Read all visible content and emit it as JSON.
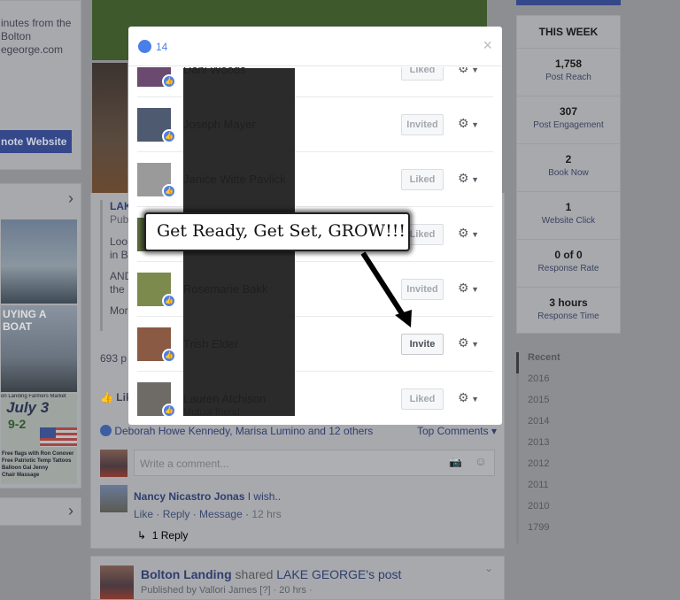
{
  "left": {
    "about_lines": [
      "inutes from the",
      "Bolton",
      "egeorge.com"
    ],
    "promote_button": "note Website",
    "arrow": "›",
    "flyer": {
      "banner": "UYING A BOAT",
      "market": "on Landing Farmers Market",
      "date": "July 3",
      "time": "9-2",
      "features": [
        "Free flags with Ron Conover",
        "Free Patriotic Temp Tattoos",
        "Balloon Gal Jenny",
        "Chair Massage"
      ]
    }
  },
  "post": {
    "page_name": "LAK",
    "published": "Pub",
    "text_lines": [
      "Loo",
      "in B",
      "AND",
      "the"
    ],
    "more": "Mor",
    "reach": "693 p",
    "like_label": "Lik",
    "likers": "Deborah Howe Kennedy, Marisa Lumino and 12 others",
    "top_comments": "Top Comments ▾",
    "comment_placeholder": "Write a comment...",
    "comment": {
      "author": "Nancy Nicastro Jonas",
      "text": "I wish..",
      "actions": [
        "Like",
        "Reply",
        "Message"
      ],
      "time": "12 hrs",
      "replies": "1 Reply"
    }
  },
  "next_post": {
    "page": "Bolton Landing",
    "action": "shared",
    "source": "LAKE GEORGE's post",
    "meta": "Published by Vallori James [?] · 20 hrs ·"
  },
  "insights": {
    "title": "THIS WEEK",
    "stats": [
      {
        "value": "1,758",
        "label": "Post Reach"
      },
      {
        "value": "307",
        "label": "Post Engagement"
      },
      {
        "value": "2",
        "label": "Book Now"
      },
      {
        "value": "1",
        "label": "Website Click"
      },
      {
        "value": "0 of 0",
        "label": "Response Rate"
      },
      {
        "value": "3 hours",
        "label": "Response Time"
      }
    ]
  },
  "timeline": [
    "Recent",
    "2016",
    "2015",
    "2014",
    "2013",
    "2012",
    "2011",
    "2010",
    "1799"
  ],
  "modal": {
    "like_count": "14",
    "close": "×",
    "rows": [
      {
        "name": "Dani Woods",
        "status": "Liked",
        "avatar": "#6a4a6e"
      },
      {
        "name": "Joseph Mayer",
        "status": "Invited",
        "avatar": "#4e5a70"
      },
      {
        "name": "Janice Witte Pavlick",
        "status": "Liked",
        "avatar": "#9a9a9a"
      },
      {
        "name": "",
        "status": "Liked",
        "avatar": "#5b6b3d"
      },
      {
        "name": "Rosemarie Bakk",
        "status": "Invited",
        "avatar": "#7c8a4e"
      },
      {
        "name": "Trish Elder",
        "status": "Invite",
        "avatar": "#8a5a44"
      },
      {
        "name": "Lauren Atchison",
        "sub": "Mutual friend",
        "status": "Liked",
        "avatar": "#6e6a66"
      }
    ]
  },
  "callout": "Get Ready, Get Set, GROW!!!",
  "colors": {
    "accent": "#4a7ee8",
    "overlay_bg": "#8d8e92",
    "button_blue": "#3b5998"
  }
}
